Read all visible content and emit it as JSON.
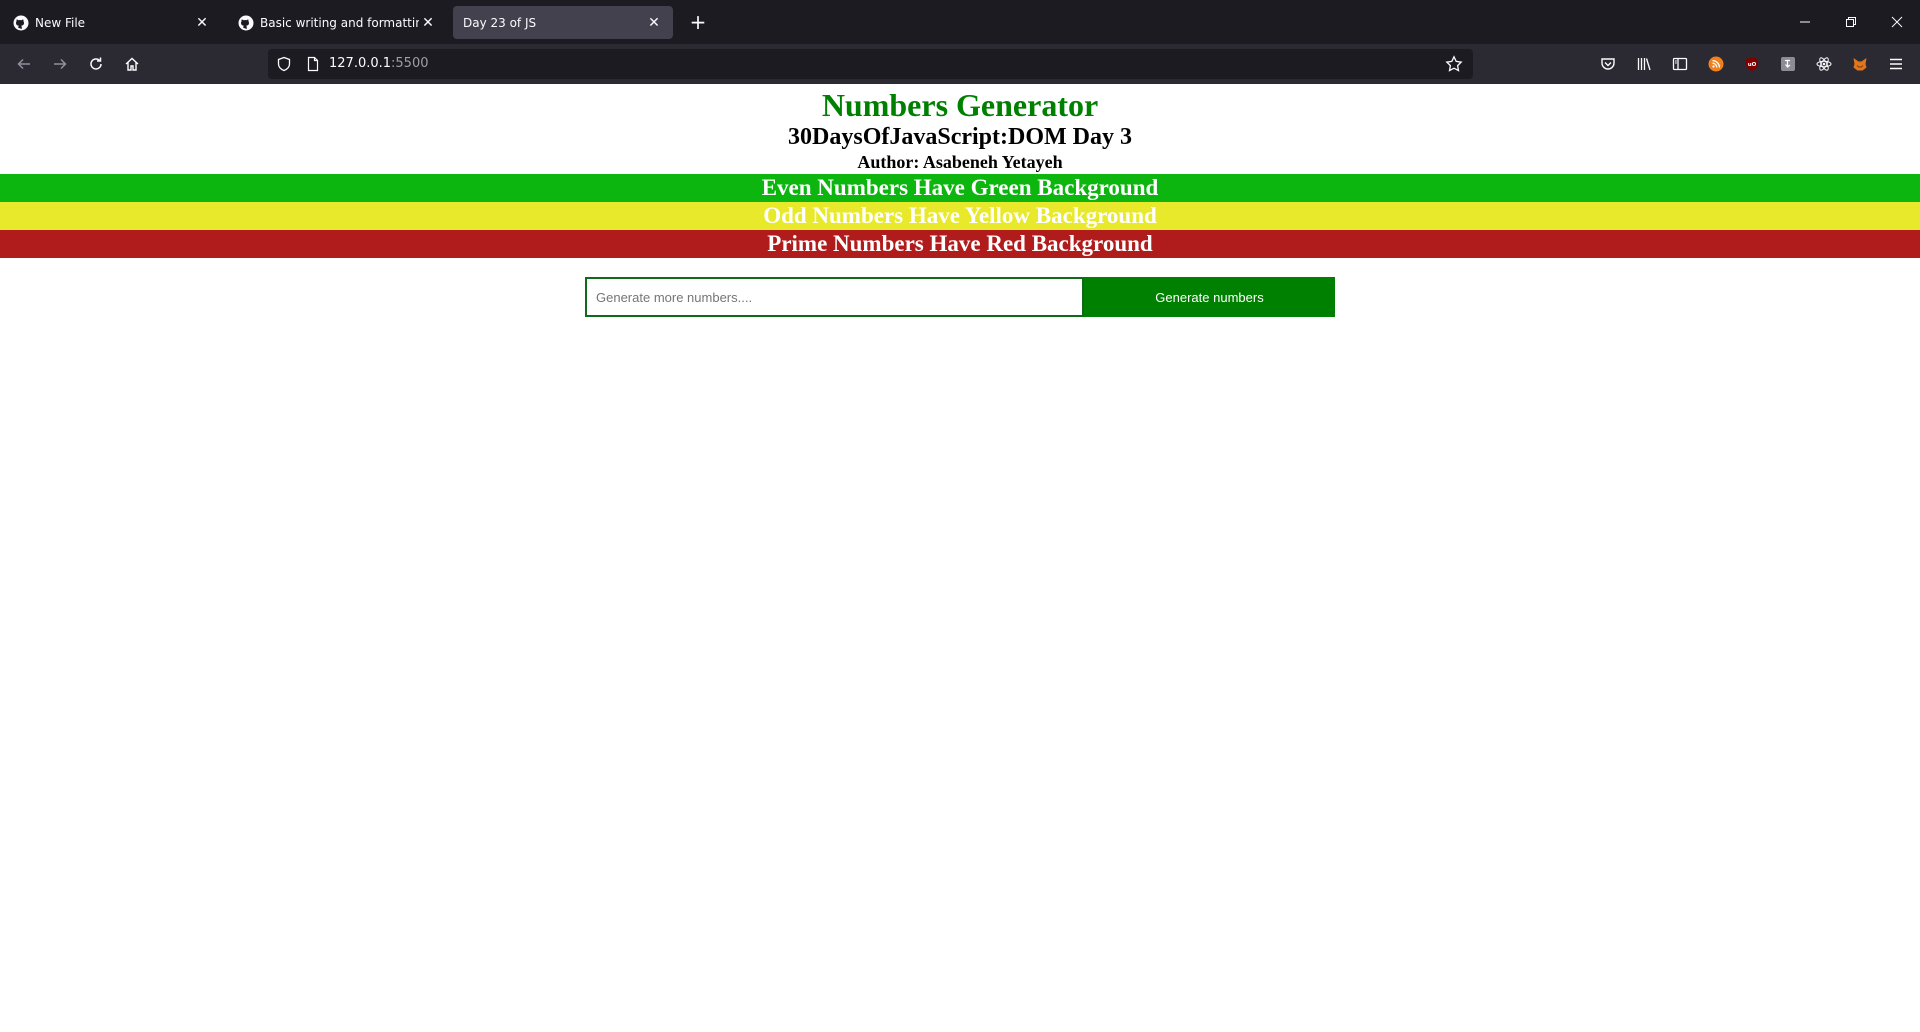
{
  "browser": {
    "tabs": [
      {
        "title": "New File",
        "icon": "github-icon",
        "active": false
      },
      {
        "title": "Basic writing and formatting syntax",
        "icon": "github-icon",
        "active": false
      },
      {
        "title": "Day 23 of JS",
        "icon": "",
        "active": true
      }
    ],
    "url_host": "127.0.0.1",
    "url_port": ":5500"
  },
  "page": {
    "title": "Numbers Generator",
    "subtitle": "30DaysOfJavaScript:DOM Day 3",
    "author": "Author: Asabeneh Yetayeh",
    "legend": {
      "even": "Even Numbers Have Green Background",
      "odd": "Odd Numbers Have Yellow Background",
      "prime": "Prime Numbers Have Red Background"
    },
    "input_placeholder": "Generate more numbers....",
    "button_label": "Generate numbers"
  },
  "colors": {
    "title": "#008000",
    "even": "#0db50f",
    "odd": "#e8e92b",
    "prime": "#b01c1c",
    "button": "#008000"
  }
}
